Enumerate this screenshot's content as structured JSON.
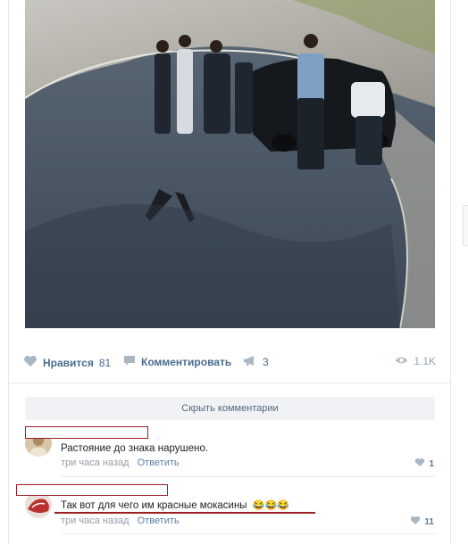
{
  "post": {
    "photo_description": "photo",
    "actions": {
      "like_label": "Нравится",
      "like_count": "81",
      "comment_label": "Комментировать",
      "share_count": "3",
      "views_count": "1.1K"
    }
  },
  "comments_section": {
    "hide_label": "Скрыть комментарии",
    "items": [
      {
        "text": "Растояние до знака нарушено.",
        "time": "три часа назад",
        "reply_label": "Ответить",
        "likes": "1"
      },
      {
        "text": "Так вот для чего им красные мокасины",
        "emoji_text": "😂😂😂",
        "time": "три часа назад",
        "reply_label": "Ответить",
        "likes": "11"
      }
    ]
  },
  "colors": {
    "link": "#4a6c8f",
    "meta": "#939ca6",
    "redaction": "#9b1f22",
    "button_bg": "#f0f2f5"
  }
}
